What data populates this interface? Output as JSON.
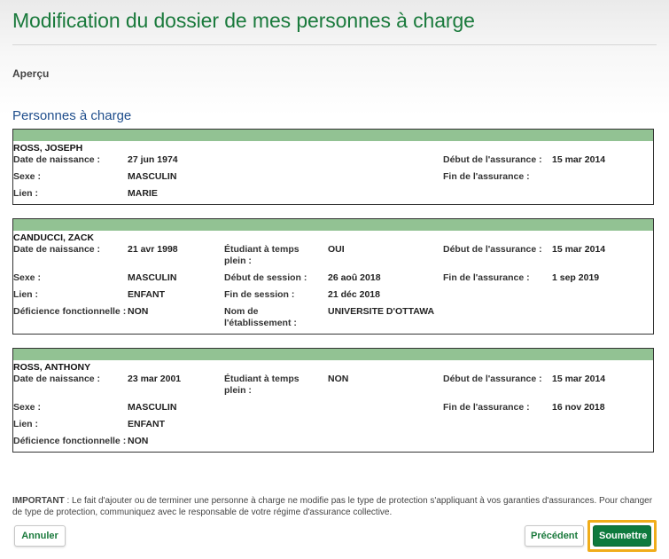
{
  "page": {
    "title": "Modification du dossier de mes personnes à charge",
    "section_label": "Aperçu",
    "section_heading": "Personnes à charge"
  },
  "dependents": [
    {
      "name": "ROSS, JOSEPH",
      "birth_label": "Date de naissance :",
      "birth": "27 jun 1974",
      "sex_label": "Sexe :",
      "sex": "MASCULIN",
      "relation_label": "Lien :",
      "relation": "MARIE",
      "start_label": "Début de l'assurance :",
      "start": "15 mar 2014",
      "end_label": "Fin de l'assurance :",
      "end": ""
    },
    {
      "name": "CANDUCCI, ZACK",
      "birth_label": "Date de naissance :",
      "birth": "21 avr 1998",
      "student_label": "Étudiant à temps plein :",
      "student": "OUI",
      "start_label": "Début de l'assurance :",
      "start": "15 mar 2014",
      "sex_label": "Sexe :",
      "sex": "MASCULIN",
      "session_start_label": "Début de session :",
      "session_start": "26 aoû 2018",
      "end_label": "Fin de l'assurance :",
      "end": "1 sep 2019",
      "relation_label": "Lien :",
      "relation": "ENFANT",
      "session_end_label": "Fin de session :",
      "session_end": "21 déc 2018",
      "disability_label": "Déficience fonctionnelle :",
      "disability": "NON",
      "institution_label": "Nom de l'établissement :",
      "institution": "UNIVERSITE D'OTTAWA"
    },
    {
      "name": "ROSS, ANTHONY",
      "birth_label": "Date de naissance :",
      "birth": "23 mar 2001",
      "student_label": "Étudiant à temps plein :",
      "student": "NON",
      "start_label": "Début de l'assurance :",
      "start": "15 mar 2014",
      "sex_label": "Sexe :",
      "sex": "MASCULIN",
      "end_label": "Fin de l'assurance :",
      "end": "16 nov 2018",
      "relation_label": "Lien :",
      "relation": "ENFANT",
      "disability_label": "Déficience fonctionnelle :",
      "disability": "NON"
    }
  ],
  "footer": {
    "important_label": "IMPORTANT",
    "important_text": " : Le fait d'ajouter ou de terminer une personne à charge ne modifie pas le type de protection s'appliquant à vos garanties d'assurances. Pour changer de type de protection, communiquez avec le responsable de votre régime d'assurance collective."
  },
  "buttons": {
    "cancel": "Annuler",
    "previous": "Précédent",
    "submit": "Soumettre"
  },
  "colors": {
    "title_green": "#1a7a3c",
    "heading_blue": "#1f4e8c",
    "card_bar_green": "#92c293",
    "submit_green": "#0e7a3d",
    "highlight_orange": "#f0ad1a"
  }
}
